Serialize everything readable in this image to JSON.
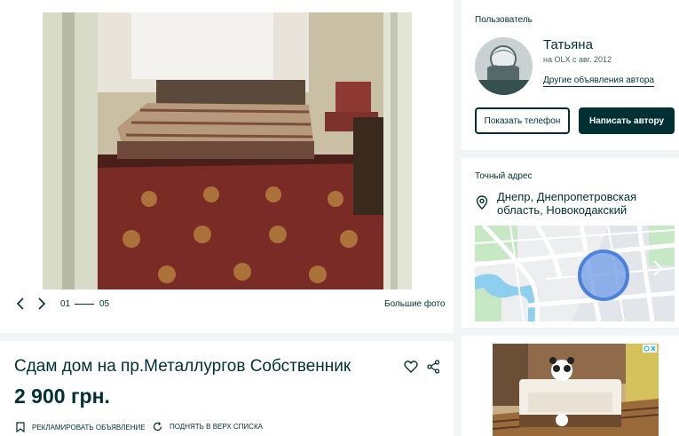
{
  "gallery": {
    "counter_current": "01",
    "counter_total": "05",
    "bigger_photo_label": "Большие фото"
  },
  "user": {
    "section_label": "Пользователь",
    "name": "Татьяна",
    "since": "на OLX с авг. 2012",
    "other_ads_link": "Другие объявления автора",
    "show_phone_label": "Показать телефон",
    "write_author_label": "Написать автору"
  },
  "address": {
    "section_label": "Точный адрес",
    "text": "Днепр, Днепропетровская область, Новокодакский",
    "icon": "location-pin-icon"
  },
  "listing": {
    "title": "Сдам дом на пр.Металлургов Собственник",
    "price": "2 900 грн.",
    "promote_label": "РЕКЛАМИРОВАТЬ ОБЪЯВЛЕНИЕ",
    "raise_label": "ПОДНЯТЬ В ВЕРХ СПИСКА"
  },
  "colors": {
    "brand_dark": "#002f34",
    "page_bg": "#f2f4f5",
    "map_marker": "#3a7bd5"
  }
}
